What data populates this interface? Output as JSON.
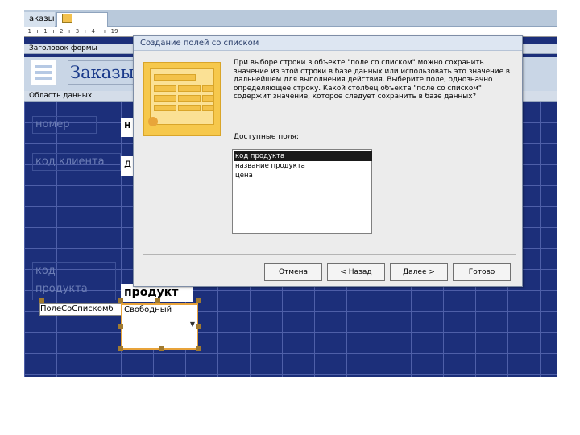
{
  "tabs": [
    {
      "label": "аказы"
    },
    {
      "label": "Заказы"
    }
  ],
  "ruler": {
    "marks": "· 1 · ı · 1 · ı · 2 · ı · 3 · ı · 4 ·                                                                                                                       · ı · 19 ·"
  },
  "form": {
    "header_section": "Заголовок формы",
    "title": "Заказы",
    "detail_section": "Область данных"
  },
  "fields": {
    "nomer_label": "номер",
    "nomer_value": "н",
    "client_label": "код клиента",
    "client_value": "д",
    "product_label_line1": "код",
    "product_label_line2": "продукта",
    "product_value": "продукт"
  },
  "combo": {
    "label": "ПолеСоСпискомб",
    "value": "Свободный"
  },
  "dialog": {
    "title": "Создание полей со списком",
    "description": "При выборе строки в объекте \"поле со списком\" можно сохранить значение из этой строки в базе данных или использовать это значение в дальнейшем для выполнения действия. Выберите поле, однозначно определяющее строку. Какой столбец объекта \"поле со списком\" содержит значение, которое следует сохранить в базе данных?",
    "available_label": "Доступные поля:",
    "fields": [
      {
        "label": "код продукта",
        "selected": true
      },
      {
        "label": "название продукта",
        "selected": false
      },
      {
        "label": "цена",
        "selected": false
      }
    ],
    "buttons": {
      "cancel": "Отмена",
      "back": "< Назад",
      "next": "Далее >",
      "finish": "Готово"
    }
  }
}
